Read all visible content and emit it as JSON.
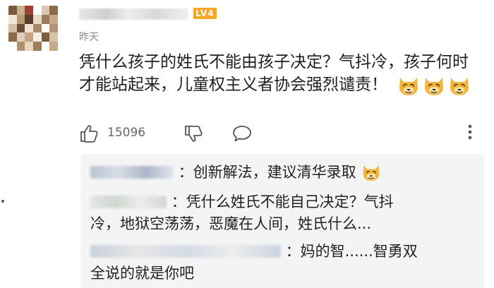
{
  "comment": {
    "level_badge": "LV4",
    "time": "昨天",
    "text": "凭什么孩子的姓氏不能由孩子决定？气抖冷，孩子何时才能站起来，儿童权主义者协会强烈谴责！",
    "emoji": "doge-emoji",
    "emoji_count": 3,
    "like_count": "15096"
  },
  "replies": [
    {
      "text": "：创新解法，建议清华录取",
      "emoji": "doge-emoji"
    },
    {
      "text": "：凭什么姓氏不能自己决定？气抖",
      "text2": "冷，地狱空荡荡，恶魔在人间，姓氏什么..."
    },
    {
      "text": "：妈的智......智勇双",
      "text2": "全说的就是你吧"
    }
  ],
  "colors": {
    "badge": "#f6a623",
    "meta_gray": "#8a8a8a",
    "reply_bg": "#f4f4f4"
  }
}
